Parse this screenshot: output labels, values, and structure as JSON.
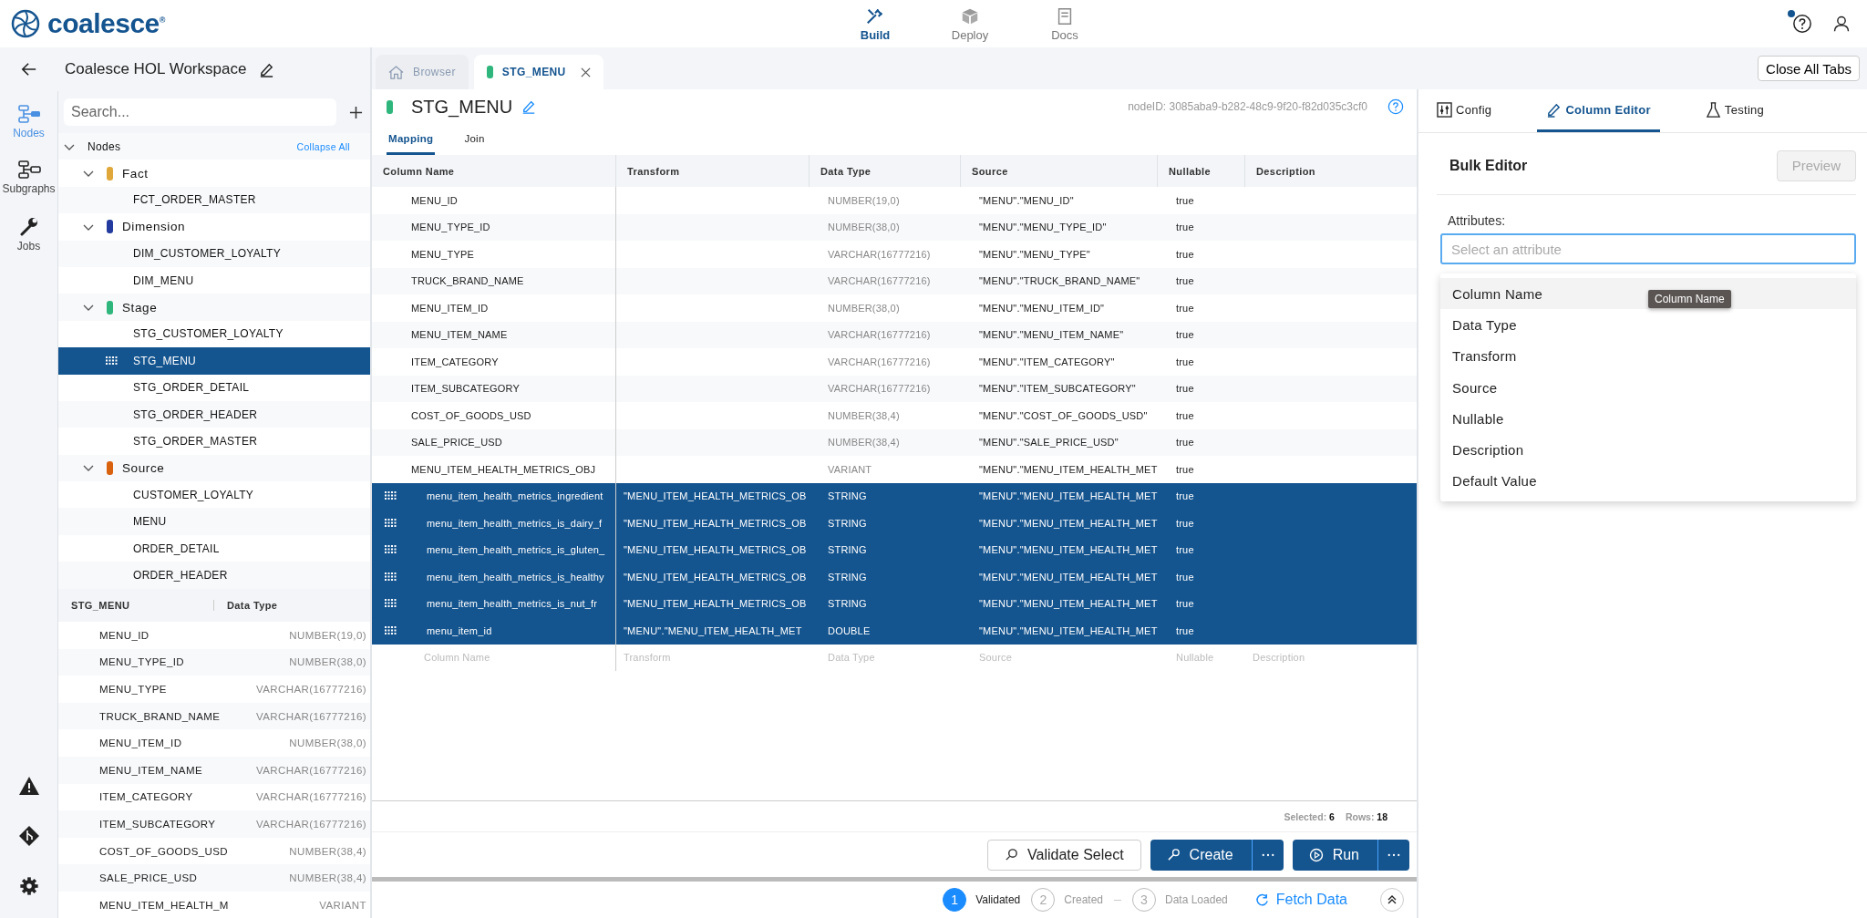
{
  "topbar": {
    "logo": "coalesce$^{®}$",
    "notification": true,
    "nav": [
      {
        "label": "Build",
        "selected": true
      },
      {
        "label": "Deploy",
        "selected": false
      },
      {
        "label": "Docs",
        "selected": false
      }
    ]
  },
  "workspace": {
    "title": "Coalesce HOL Workspace"
  },
  "rail": [
    {
      "label": "Nodes",
      "selected": true
    },
    {
      "label": "Subgraphs",
      "selected": false
    },
    {
      "label": "Jobs",
      "selected": false
    }
  ],
  "search": {
    "placeholder": "Search..."
  },
  "tree": {
    "label": "Nodes",
    "expanded": true,
    "action": "Collapse All",
    "children": [
      {
        "label": "Fact",
        "color": "#e0a83a",
        "expanded": true,
        "children": [
          {
            "label": "FCT_ORDER_MASTER",
            "selected": false
          }
        ]
      },
      {
        "label": "Dimension",
        "color": "#233a9e",
        "expanded": true,
        "children": [
          {
            "label": "DIM_CUSTOMER_LOYALTY",
            "selected": false
          },
          {
            "label": "DIM_MENU",
            "selected": false
          }
        ]
      },
      {
        "label": "Stage",
        "color": "#2fb67c",
        "expanded": true,
        "children": [
          {
            "label": "STG_CUSTOMER_LOYALTY",
            "selected": false
          },
          {
            "label": "STG_MENU",
            "selected": true
          },
          {
            "label": "STG_ORDER_DETAIL",
            "selected": false
          },
          {
            "label": "STG_ORDER_HEADER",
            "selected": false
          },
          {
            "label": "STG_ORDER_MASTER",
            "selected": false
          }
        ]
      },
      {
        "label": "Source",
        "color": "#d9620f",
        "expanded": true,
        "children": [
          {
            "label": "CUSTOMER_LOYALTY",
            "selected": false
          },
          {
            "label": "MENU",
            "selected": false
          },
          {
            "label": "ORDER_DETAIL",
            "selected": false
          },
          {
            "label": "ORDER_HEADER",
            "selected": false
          }
        ]
      }
    ]
  },
  "preview_table": {
    "columns": [
      "STG_MENU",
      "Data Type"
    ],
    "rows": [
      [
        "MENU_ID",
        "NUMBER(19,0)"
      ],
      [
        "MENU_TYPE_ID",
        "NUMBER(38,0)"
      ],
      [
        "MENU_TYPE",
        "VARCHAR(16777216)"
      ],
      [
        "TRUCK_BRAND_NAME",
        "VARCHAR(16777216)"
      ],
      [
        "MENU_ITEM_ID",
        "NUMBER(38,0)"
      ],
      [
        "MENU_ITEM_NAME",
        "VARCHAR(16777216)"
      ],
      [
        "ITEM_CATEGORY",
        "VARCHAR(16777216)"
      ],
      [
        "ITEM_SUBCATEGORY",
        "VARCHAR(16777216)"
      ],
      [
        "COST_OF_GOODS_USD",
        "NUMBER(38,4)"
      ],
      [
        "SALE_PRICE_USD",
        "NUMBER(38,4)"
      ],
      [
        "MENU_ITEM_HEALTH_M",
        "VARIANT"
      ]
    ]
  },
  "tabs": [
    {
      "label": "Browser",
      "kind": "home",
      "selected": false
    },
    {
      "label": "STG_MENU",
      "kind": "node",
      "selected": true
    }
  ],
  "close_all": "Close All Tabs",
  "node": {
    "title": "STG_MENU",
    "node_id": "nodeID: 3085aba9-b282-48c9-9f20-f82d035c3cf0",
    "subtabs": [
      {
        "label": "Mapping",
        "selected": true
      },
      {
        "label": "Join",
        "selected": false
      }
    ]
  },
  "table": {
    "columns": [
      "Column Name",
      "Transform",
      "Data Type",
      "Source",
      "Nullable",
      "Description"
    ],
    "rows": [
      {
        "column_name": "MENU_ID",
        "data_type": "NUMBER(19,0)",
        "source": "\"MENU\".\"MENU_ID\"",
        "nullable": "true",
        "selected": false
      },
      {
        "column_name": "MENU_TYPE_ID",
        "data_type": "NUMBER(38,0)",
        "source": "\"MENU\".\"MENU_TYPE_ID\"",
        "nullable": "true",
        "selected": false
      },
      {
        "column_name": "MENU_TYPE",
        "data_type": "VARCHAR(16777216)",
        "source": "\"MENU\".\"MENU_TYPE\"",
        "nullable": "true",
        "selected": false
      },
      {
        "column_name": "TRUCK_BRAND_NAME",
        "data_type": "VARCHAR(16777216)",
        "source": "\"MENU\".\"TRUCK_BRAND_NAME\"",
        "nullable": "true",
        "selected": false
      },
      {
        "column_name": "MENU_ITEM_ID",
        "data_type": "NUMBER(38,0)",
        "source": "\"MENU\".\"MENU_ITEM_ID\"",
        "nullable": "true",
        "selected": false
      },
      {
        "column_name": "MENU_ITEM_NAME",
        "data_type": "VARCHAR(16777216)",
        "source": "\"MENU\".\"MENU_ITEM_NAME\"",
        "nullable": "true",
        "selected": false
      },
      {
        "column_name": "ITEM_CATEGORY",
        "data_type": "VARCHAR(16777216)",
        "source": "\"MENU\".\"ITEM_CATEGORY\"",
        "nullable": "true",
        "selected": false
      },
      {
        "column_name": "ITEM_SUBCATEGORY",
        "data_type": "VARCHAR(16777216)",
        "source": "\"MENU\".\"ITEM_SUBCATEGORY\"",
        "nullable": "true",
        "selected": false
      },
      {
        "column_name": "COST_OF_GOODS_USD",
        "data_type": "NUMBER(38,4)",
        "source": "\"MENU\".\"COST_OF_GOODS_USD\"",
        "nullable": "true",
        "selected": false
      },
      {
        "column_name": "SALE_PRICE_USD",
        "data_type": "NUMBER(38,4)",
        "source": "\"MENU\".\"SALE_PRICE_USD\"",
        "nullable": "true",
        "selected": false
      },
      {
        "column_name": "MENU_ITEM_HEALTH_METRICS_OBJ",
        "data_type": "VARIANT",
        "source": "\"MENU\".\"MENU_ITEM_HEALTH_MET",
        "nullable": "true",
        "selected": false
      },
      {
        "column_name": "menu_item_health_metrics_ingredient",
        "transform": "\"MENU_ITEM_HEALTH_METRICS_OB",
        "data_type": "STRING",
        "source": "\"MENU\".\"MENU_ITEM_HEALTH_MET",
        "nullable": "true",
        "selected": true
      },
      {
        "column_name": "menu_item_health_metrics_is_dairy_f",
        "transform": "\"MENU_ITEM_HEALTH_METRICS_OB",
        "data_type": "STRING",
        "source": "\"MENU\".\"MENU_ITEM_HEALTH_MET",
        "nullable": "true",
        "selected": true
      },
      {
        "column_name": "menu_item_health_metrics_is_gluten_",
        "transform": "\"MENU_ITEM_HEALTH_METRICS_OB",
        "data_type": "STRING",
        "source": "\"MENU\".\"MENU_ITEM_HEALTH_MET",
        "nullable": "true",
        "selected": true
      },
      {
        "column_name": "menu_item_health_metrics_is_healthy",
        "transform": "\"MENU_ITEM_HEALTH_METRICS_OB",
        "data_type": "STRING",
        "source": "\"MENU\".\"MENU_ITEM_HEALTH_MET",
        "nullable": "true",
        "selected": true
      },
      {
        "column_name": "menu_item_health_metrics_is_nut_fr",
        "transform": "\"MENU_ITEM_HEALTH_METRICS_OB",
        "data_type": "STRING",
        "source": "\"MENU\".\"MENU_ITEM_HEALTH_MET",
        "nullable": "true",
        "selected": true
      },
      {
        "column_name": "menu_item_id",
        "transform": "\"MENU\".\"MENU_ITEM_HEALTH_MET",
        "data_type": "DOUBLE",
        "source": "\"MENU\".\"MENU_ITEM_HEALTH_MET",
        "nullable": "true",
        "selected": true
      }
    ],
    "placeholders": [
      "Column Name",
      "Transform",
      "Data Type",
      "Source",
      "Nullable",
      "Description"
    ]
  },
  "status": {
    "selected_label": "Selected:",
    "selected_count": "6",
    "rows_label": "Rows:",
    "rows_count": "18"
  },
  "actions": [
    {
      "label": "Validate Select",
      "kind": "outline"
    },
    {
      "label": "Create",
      "kind": "split"
    },
    {
      "label": "Run",
      "kind": "split"
    }
  ],
  "steps": [
    {
      "number": "1",
      "label": "Validated",
      "done": true
    },
    {
      "number": "2",
      "label": "Created",
      "done": false
    },
    {
      "number": "3",
      "label": "Data Loaded",
      "done": false
    }
  ],
  "fetch": "Fetch Data",
  "right_tabs": [
    {
      "label": "Config",
      "selected": false
    },
    {
      "label": "Column Editor",
      "selected": true
    },
    {
      "label": "Testing",
      "selected": false
    }
  ],
  "bulk_editor": {
    "title": "Bulk Editor",
    "preview": {
      "label": "Preview",
      "disabled": true
    },
    "attributes_label": "Attributes:",
    "field": {
      "placeholder": "Select an attribute",
      "focused": true
    },
    "options": [
      {
        "label": "Column Name",
        "highlighted": true
      },
      {
        "label": "Data Type",
        "highlighted": false
      },
      {
        "label": "Transform",
        "highlighted": false
      },
      {
        "label": "Source",
        "highlighted": false
      },
      {
        "label": "Nullable",
        "highlighted": false
      },
      {
        "label": "Description",
        "highlighted": false
      },
      {
        "label": "Default Value",
        "highlighted": false
      }
    ],
    "tooltip": "Column Name"
  }
}
